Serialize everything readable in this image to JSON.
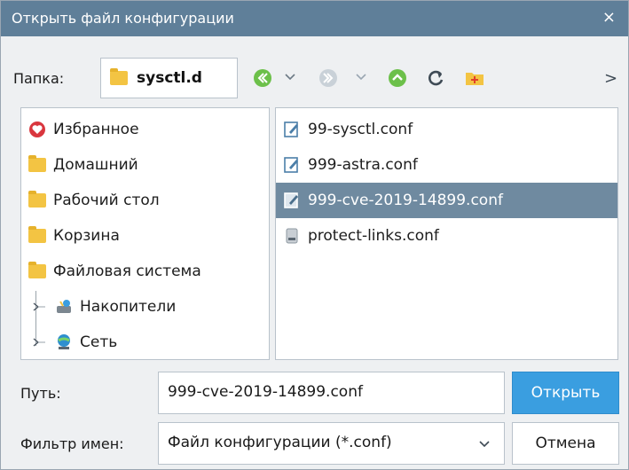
{
  "dialog": {
    "title": "Открыть файл конфигурации",
    "close_glyph": "×"
  },
  "toolbar": {
    "folder_label": "Папка:",
    "current_folder": "sysctl.d",
    "more_glyph": ">",
    "icons": [
      "back-icon",
      "chevron-down-icon",
      "forward-icon",
      "chevron-down-icon",
      "up-icon",
      "refresh-icon",
      "new-folder-icon"
    ]
  },
  "places": [
    {
      "label": "Избранное",
      "icon": "favorites-icon"
    },
    {
      "label": "Домашний",
      "icon": "folder-icon"
    },
    {
      "label": "Рабочий стол",
      "icon": "folder-icon"
    },
    {
      "label": "Корзина",
      "icon": "folder-icon"
    },
    {
      "label": "Файловая система",
      "icon": "folder-icon"
    },
    {
      "label": "Накопители",
      "icon": "drives-icon"
    },
    {
      "label": "Сеть",
      "icon": "network-icon"
    }
  ],
  "files": [
    {
      "name": "99-sysctl.conf",
      "icon": "text-file-icon",
      "selected": false
    },
    {
      "name": "999-astra.conf",
      "icon": "text-file-icon",
      "selected": false
    },
    {
      "name": "999-cve-2019-14899.conf",
      "icon": "text-file-icon",
      "selected": true
    },
    {
      "name": "protect-links.conf",
      "icon": "binary-file-icon",
      "selected": false
    }
  ],
  "path": {
    "label": "Путь:",
    "value": "999-cve-2019-14899.conf",
    "open_button": "Открыть"
  },
  "filter": {
    "label": "Фильтр имен:",
    "value": "Файл конфигурации (*.conf)",
    "cancel_button": "Отмена"
  },
  "colors": {
    "titlebar": "#5f7f99",
    "selection": "#6f8aa0",
    "primary_button": "#3a9ee0",
    "nav_green": "#6cc04a",
    "folder_yellow": "#f3c443"
  }
}
